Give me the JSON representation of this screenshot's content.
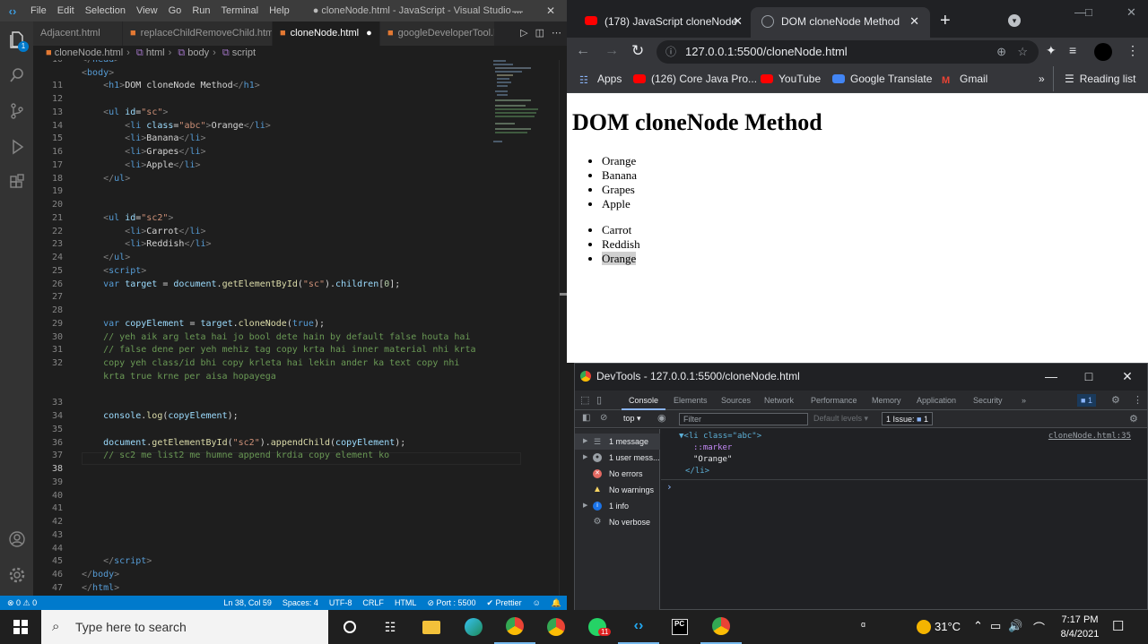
{
  "vscode": {
    "menu": [
      "File",
      "Edit",
      "Selection",
      "View",
      "Go",
      "Run",
      "Terminal",
      "Help"
    ],
    "window_title": "● cloneNode.html - JavaScript - Visual Studio ...",
    "tabs": [
      {
        "label": "Adjacent.html"
      },
      {
        "label": "replaceChildRemoveChild.html"
      },
      {
        "label": "cloneNode.html",
        "active": true,
        "modified": true
      },
      {
        "label": "googleDeveloperTool.ht"
      }
    ],
    "source_control_badge": "1",
    "breadcrumb": [
      "cloneNode.html",
      "html",
      "body",
      "script"
    ],
    "line_numbers": [
      "10",
      "11",
      "12",
      "13",
      "14",
      "15",
      "16",
      "17",
      "18",
      "19",
      "20",
      "21",
      "22",
      "23",
      "24",
      "25",
      "26",
      "27",
      "28",
      "29",
      "30",
      "31",
      "32",
      "33",
      "34",
      "35",
      "36",
      "37",
      "38",
      "39",
      "40",
      "41",
      "42",
      "43",
      "44",
      "45",
      "46",
      "47",
      "48"
    ],
    "current_line": "38",
    "statusbar": {
      "problems": "⊗ 0 ⚠ 0",
      "position": "Ln 38, Col 59",
      "spaces": "Spaces: 4",
      "encoding": "UTF-8",
      "eol": "CRLF",
      "language": "HTML",
      "port": "⊘ Port : 5500",
      "formatter": "✔ Prettier"
    }
  },
  "chrome": {
    "tabs": [
      {
        "label": "(178) JavaScript cloneNode",
        "close": "✕"
      },
      {
        "label": "DOM cloneNode Method",
        "close": "✕",
        "active": true
      }
    ],
    "new_tab": "+",
    "url": "127.0.0.1:5500/cloneNode.html",
    "bookmarks": [
      "Apps",
      "(126) Core Java Pro...",
      "YouTube",
      "Google Translate",
      "Gmail"
    ],
    "more_bookmarks": "»",
    "reading_list": "Reading list",
    "page": {
      "heading": "DOM cloneNode Method",
      "list1": [
        "Orange",
        "Banana",
        "Grapes",
        "Apple"
      ],
      "list2": [
        "Carrot",
        "Reddish",
        "Orange"
      ]
    }
  },
  "devtools": {
    "title": "DevTools - 127.0.0.1:5500/cloneNode.html",
    "tabs": [
      "Console",
      "Elements",
      "Sources",
      "Network",
      "Performance",
      "Memory",
      "Application",
      "Security",
      "»"
    ],
    "active_tab": "Console",
    "issues_badge": "1",
    "context": "top",
    "filter_placeholder": "Filter",
    "levels": "Default levels ▾",
    "issues_label": "1 Issue:",
    "issues_count": "1",
    "sidebar": [
      "1 message",
      "1 user mess...",
      "No errors",
      "No warnings",
      "1 info",
      "No verbose"
    ],
    "log_source": "cloneNode.html:35",
    "log_lines": [
      "▼<li class=\"abc\">",
      "::marker",
      "\"Orange\"",
      "</li>"
    ],
    "prompt": "›"
  },
  "taskbar": {
    "search_placeholder": "Type here to search",
    "weather": "31°C",
    "time": "7:17 PM",
    "date": "8/4/2021",
    "whatsapp_badge": "11"
  }
}
